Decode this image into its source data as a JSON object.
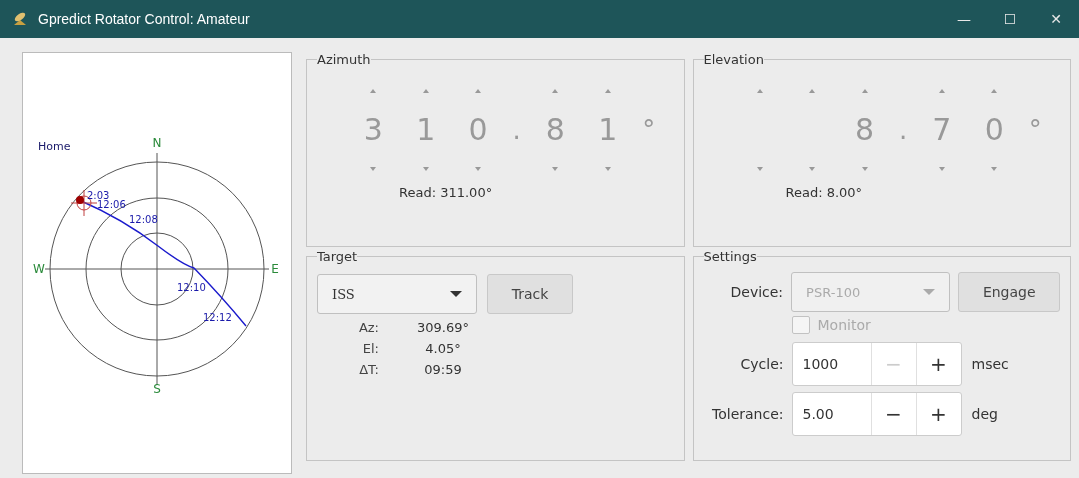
{
  "window": {
    "title": "Gpredict Rotator Control: Amateur",
    "controls": [
      "—",
      "☐",
      "✕"
    ]
  },
  "polar": {
    "home_label": "Home",
    "compass": [
      "N",
      "E",
      "S",
      "W"
    ],
    "track_times": [
      "2:03",
      "12:06",
      "12:08",
      "12:10",
      "12:12"
    ]
  },
  "azimuth": {
    "title": "Azimuth",
    "digits": [
      "3",
      "1",
      "0",
      "8",
      "1"
    ],
    "decimal_point": ".",
    "unit": "°",
    "read": "Read: 311.00°"
  },
  "elevation": {
    "title": "Elevation",
    "digits": [
      "8",
      "7",
      "0"
    ],
    "decimal_point": ".",
    "unit": "°",
    "read": "Read:  8.00°"
  },
  "target": {
    "title": "Target",
    "satellite": "ISS",
    "track_button": "Track",
    "rows": [
      {
        "label": "Az:",
        "value": "309.69°"
      },
      {
        "label": "El:",
        "value": "4.05°"
      },
      {
        "label": "ΔT:",
        "value": "09:59"
      }
    ]
  },
  "settings": {
    "title": "Settings",
    "device_label": "Device:",
    "device": "PSR-100",
    "device_disabled": true,
    "engage_button": "Engage",
    "monitor": {
      "label": "Monitor",
      "checked": false,
      "disabled": true
    },
    "spinners": [
      {
        "label": "Cycle:",
        "value": "1000",
        "minus": "−",
        "plus": "+",
        "minus_disabled": true,
        "unit": "msec"
      },
      {
        "label": "Tolerance:",
        "value": "5.00",
        "minus": "−",
        "plus": "+",
        "minus_disabled": false,
        "unit": "deg"
      }
    ]
  }
}
